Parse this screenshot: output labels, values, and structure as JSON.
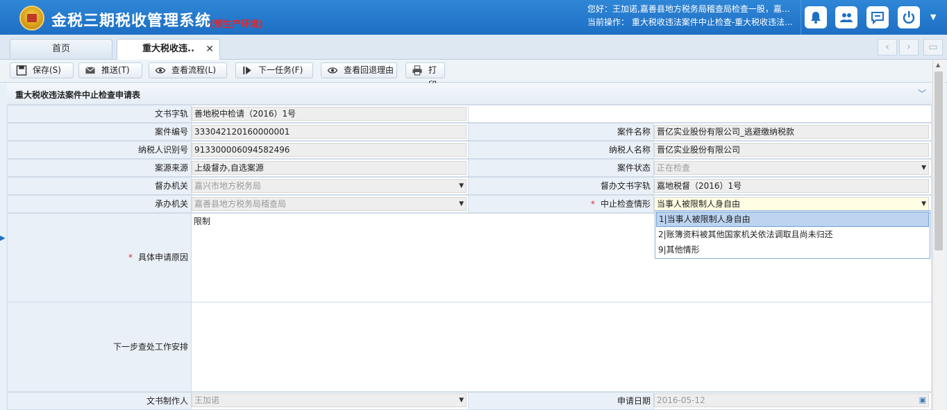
{
  "header": {
    "title": "金税三期税收管理系统",
    "env": "(预生产环境)",
    "greeting": "您好：王加诺,嘉善县地方税务局稽查局检查一股，嘉善...",
    "current_op": "当前操作： 重大税收违法案件中止检查-重大税收违法...",
    "icons": [
      "bell-icon",
      "users-icon",
      "chat-icon",
      "power-icon"
    ]
  },
  "tabs": [
    {
      "label": "首页"
    },
    {
      "label": "重大税收违.."
    }
  ],
  "toolbar": {
    "save": "保存(S)",
    "send": "推送(T)",
    "view_flow": "查看流程(L)",
    "next_task": "下一任务(F)",
    "view_return": "查看回退理由",
    "print": "打印"
  },
  "form": {
    "title": "重大税收违法案件中止检查申请表",
    "doc_no_label": "文书字轨",
    "doc_no": "善地税中检请（2016）1号",
    "case_no_label": "案件编号",
    "case_no": "333042120160000001",
    "case_name_label": "案件名称",
    "case_name": "晋亿实业股份有限公司_逃避缴纳税款",
    "taxpayer_id_label": "纳税人识别号",
    "taxpayer_id": "913300006094582496",
    "taxpayer_name_label": "纳税人名称",
    "taxpayer_name": "晋亿实业股份有限公司",
    "case_source_label": "案源来源",
    "case_source": "上级督办,自选案源",
    "case_status_label": "案件状态",
    "case_status": "正在检查",
    "supervise_org_label": "督办机关",
    "supervise_org": "嘉兴市地方税务局",
    "supervise_doc_label": "督办文书字轨",
    "supervise_doc": "嘉地税督（2016）1号",
    "handle_org_label": "承办机关",
    "handle_org": "嘉善县地方税务局稽查局",
    "suspend_label": "中止检查情形",
    "suspend_value": "当事人被限制人身自由",
    "reason_label": "具体申请原因",
    "reason_value": "限制",
    "next_step_label": "下一步查处工作安排",
    "next_step_value": "",
    "author_label": "文书制作人",
    "author": "王加诺",
    "apply_date_label": "申请日期",
    "apply_date": "2016-05-12",
    "suspend_options": [
      "1|当事人被限制人身自由",
      "2|账簿资料被其他国家机关依法调取且尚未归还",
      "9|其他情形"
    ]
  },
  "colors": {
    "header_blue": "#1d6fc4",
    "env_red": "#e0282e",
    "label_bg": "#e9f0f7",
    "selected_option": "#bcd4f0"
  }
}
